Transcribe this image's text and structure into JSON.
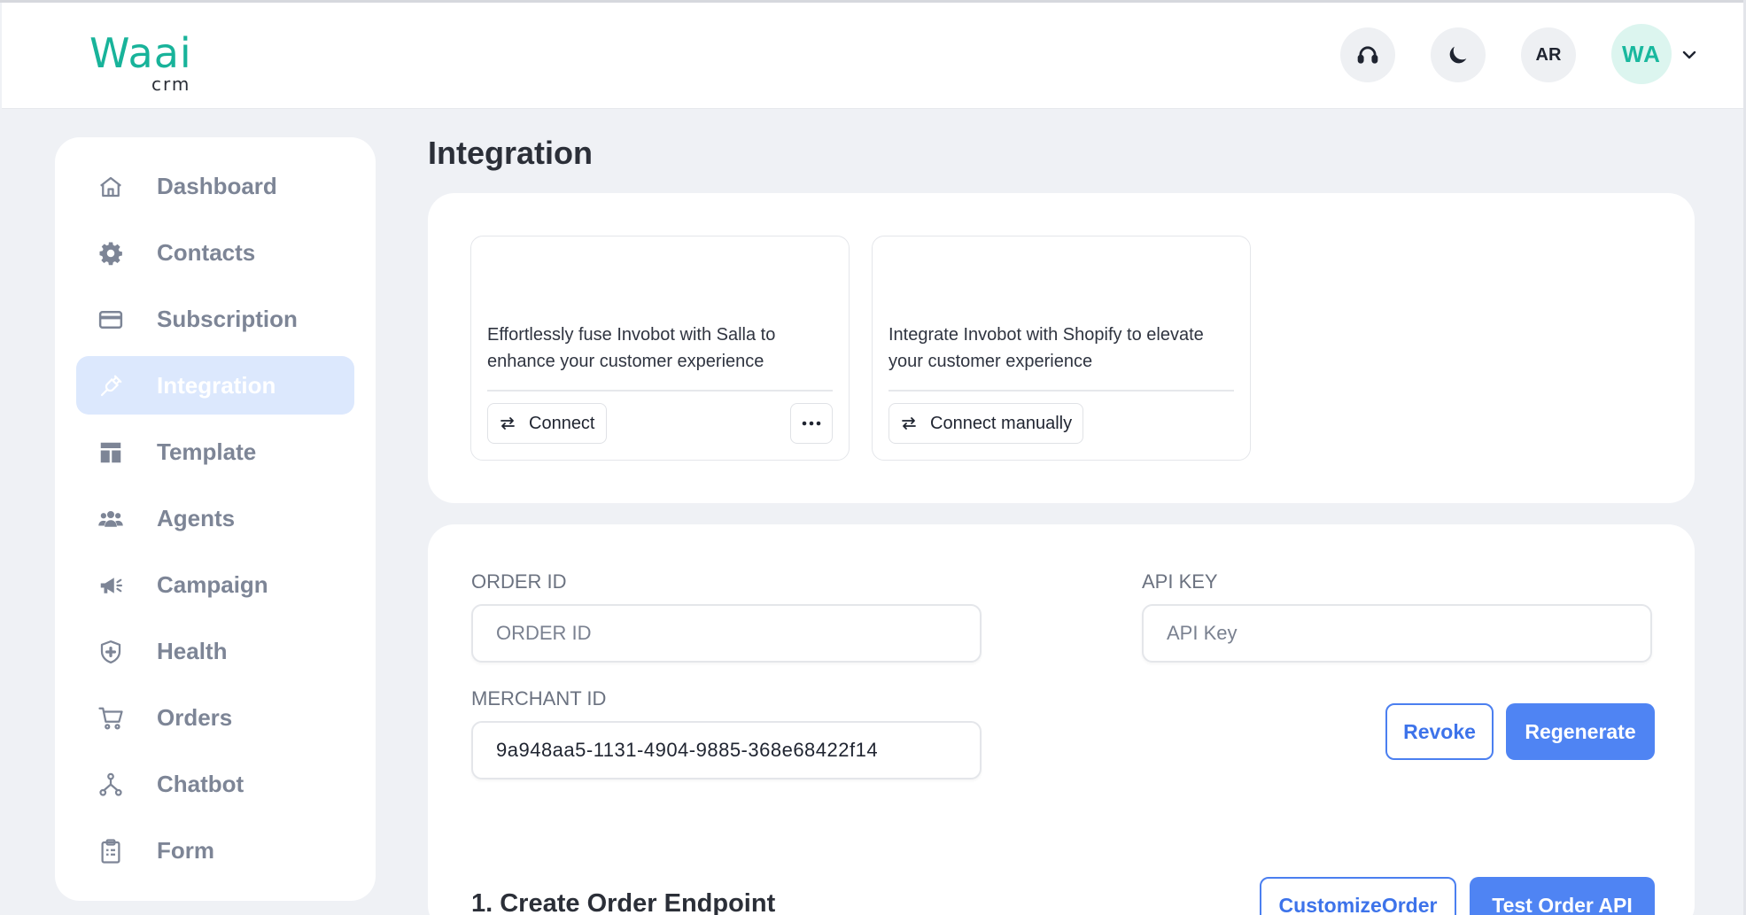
{
  "header": {
    "logo_main": "Waai",
    "logo_sub": "crm",
    "support_icon": "headset-icon",
    "theme_icon": "moon-icon",
    "language_label": "AR",
    "avatar_initials": "WA"
  },
  "sidebar": {
    "items": [
      {
        "label": "Dashboard",
        "icon": "home-icon"
      },
      {
        "label": "Contacts",
        "icon": "gear-icon"
      },
      {
        "label": "Subscription",
        "icon": "credit-card-icon"
      },
      {
        "label": "Integration",
        "icon": "plug-icon",
        "active": true
      },
      {
        "label": "Template",
        "icon": "template-icon"
      },
      {
        "label": "Agents",
        "icon": "users-icon"
      },
      {
        "label": "Campaign",
        "icon": "megaphone-icon"
      },
      {
        "label": "Health",
        "icon": "shield-plus-icon"
      },
      {
        "label": "Orders",
        "icon": "cart-icon"
      },
      {
        "label": "Chatbot",
        "icon": "network-icon"
      },
      {
        "label": "Form",
        "icon": "clipboard-icon"
      }
    ]
  },
  "main": {
    "title": "Integration",
    "cards": [
      {
        "description": "Effortlessly fuse Invobot with Salla to enhance your customer experience",
        "button_label": "Connect"
      },
      {
        "description": "Integrate Invobot with Shopify to elevate your customer experience",
        "button_label": "Connect manually"
      }
    ],
    "form": {
      "order_id_label": "ORDER ID",
      "order_id_placeholder": "ORDER ID",
      "api_key_label": "API KEY",
      "api_key_placeholder": "API Key",
      "merchant_id_label": "MERCHANT ID",
      "merchant_id_value": "9a948aa5-1131-4904-9885-368e68422f14",
      "revoke_label": "Revoke",
      "regenerate_label": "Regenerate"
    },
    "section": {
      "title": "1. Create Order Endpoint",
      "customize_label": "CustomizeOrder",
      "test_label": "Test Order API"
    }
  },
  "colors": {
    "brand": "#18b39a",
    "accent": "#4f84f3",
    "active_nav_bg": "#dce8fd",
    "background": "#eff1f5"
  }
}
